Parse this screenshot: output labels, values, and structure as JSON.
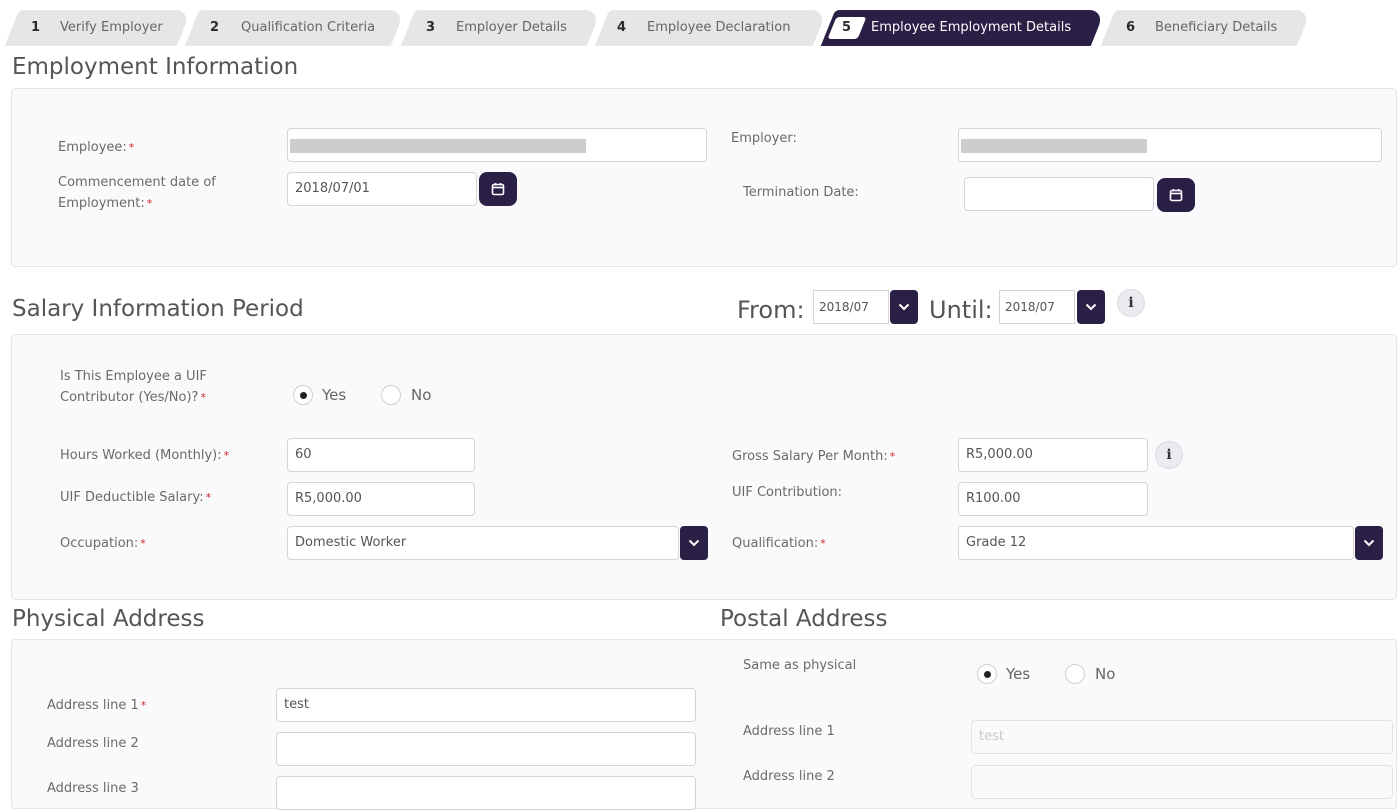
{
  "steps": [
    {
      "num": "1",
      "label": "Verify Employer"
    },
    {
      "num": "2",
      "label": "Qualification Criteria"
    },
    {
      "num": "3",
      "label": "Employer Details"
    },
    {
      "num": "4",
      "label": "Employee Declaration"
    },
    {
      "num": "5",
      "label": "Employee Employment Details"
    },
    {
      "num": "6",
      "label": "Beneficiary Details"
    }
  ],
  "active_step": "5",
  "required_mark": "*",
  "employment": {
    "title": "Employment Information",
    "employee_label": "Employee:",
    "employer_label": "Employer:",
    "commencement_label_1": "Commencement date of",
    "commencement_label_2": "Employment:",
    "commencement_value": "2018/07/01",
    "termination_label": "Termination Date:",
    "termination_value": ""
  },
  "salary": {
    "title": "Salary Information Period",
    "from_label": "From:",
    "from_value": "2018/07",
    "until_label": "Until:",
    "until_value": "2018/07",
    "uif_q_label_1": "Is This Employee a UIF",
    "uif_q_label_2": "Contributor (Yes/No)?",
    "yes": "Yes",
    "no": "No",
    "uif_contributor": "Yes",
    "hours_label": "Hours Worked (Monthly):",
    "hours_value": "60",
    "gross_label": "Gross Salary Per Month:",
    "gross_value": "R5,000.00",
    "uif_ded_label": "UIF Deductible Salary:",
    "uif_ded_value": "R5,000.00",
    "uif_contrib_label": "UIF Contribution:",
    "uif_contrib_value": "R100.00",
    "occupation_label": "Occupation:",
    "occupation_value": "Domestic Worker",
    "qualification_label": "Qualification:",
    "qualification_value": "Grade 12",
    "info_glyph": "i"
  },
  "physical": {
    "title": "Physical Address",
    "line1_label": "Address line 1",
    "line1_value": "test",
    "line2_label": "Address line 2",
    "line2_value": "",
    "line3_label": "Address line 3",
    "line3_value": ""
  },
  "postal": {
    "title": "Postal Address",
    "same_label": "Same as physical",
    "same_value": "Yes",
    "line1_label": "Address line 1",
    "line1_value": "test",
    "line2_label": "Address line 2",
    "line2_value": ""
  },
  "colors": {
    "accent": "#2a1f45",
    "required": "#c62828",
    "tab_inactive": "#e6e6e6"
  }
}
